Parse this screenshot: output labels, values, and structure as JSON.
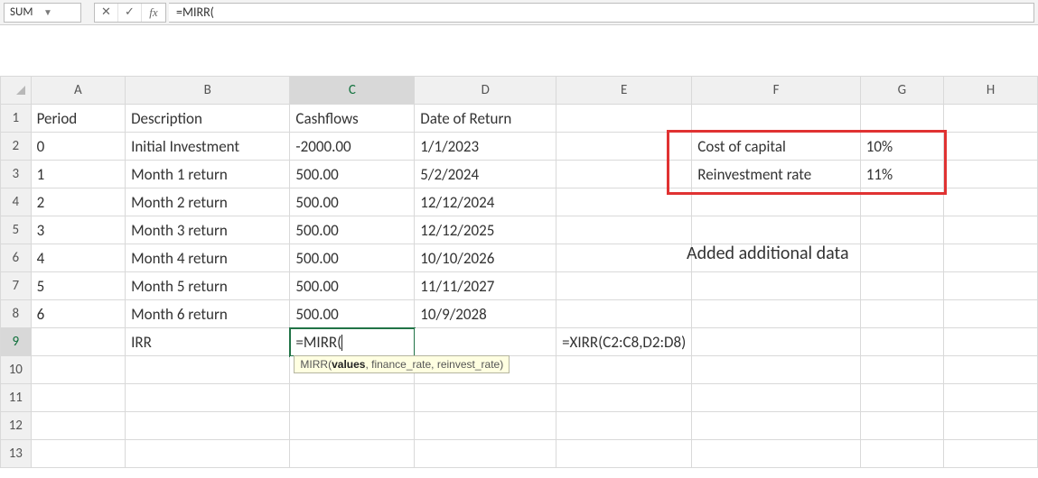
{
  "name_box": "SUM",
  "fx_buttons": {
    "cancel": "✕",
    "confirm": "✓",
    "fx": "fx"
  },
  "formula_bar": "=MIRR(",
  "columns": [
    "A",
    "B",
    "C",
    "D",
    "E",
    "F",
    "G",
    "H"
  ],
  "rows_visible": [
    1,
    2,
    3,
    4,
    5,
    6,
    7,
    8,
    9,
    10,
    11,
    12,
    13
  ],
  "headers": {
    "A1": "Period",
    "B1": "Description",
    "C1": "Cashflows",
    "D1": "Date of Return"
  },
  "data_rows": [
    {
      "period": "0",
      "desc": "Initial Investment",
      "cash": "-2000.00",
      "date": "1/1/2023"
    },
    {
      "period": "1",
      "desc": "Month 1 return",
      "cash": "500.00",
      "date": "5/2/2024"
    },
    {
      "period": "2",
      "desc": "Month 2 return",
      "cash": "500.00",
      "date": "12/12/2024"
    },
    {
      "period": "3",
      "desc": "Month 3 return",
      "cash": "500.00",
      "date": "12/12/2025"
    },
    {
      "period": "4",
      "desc": "Month 4 return",
      "cash": "500.00",
      "date": "10/10/2026"
    },
    {
      "period": "5",
      "desc": "Month 5 return",
      "cash": "500.00",
      "date": "11/11/2027"
    },
    {
      "period": "6",
      "desc": "Month 6 return",
      "cash": "500.00",
      "date": "10/9/2028"
    }
  ],
  "irr_label": "IRR",
  "editing_cell_text": "=MIRR(",
  "tooltip_parts": {
    "fn": "MIRR(",
    "arg1": "values",
    "rest": ", finance_rate, reinvest_rate)"
  },
  "xirr_formula": "=XIRR(C2:C8,D2:D8)",
  "side_params": [
    {
      "label": "Cost of capital",
      "value": "10%"
    },
    {
      "label": "Reinvestment rate",
      "value": "11%"
    }
  ],
  "annotation": "Added additional data",
  "active_cell": "C9"
}
